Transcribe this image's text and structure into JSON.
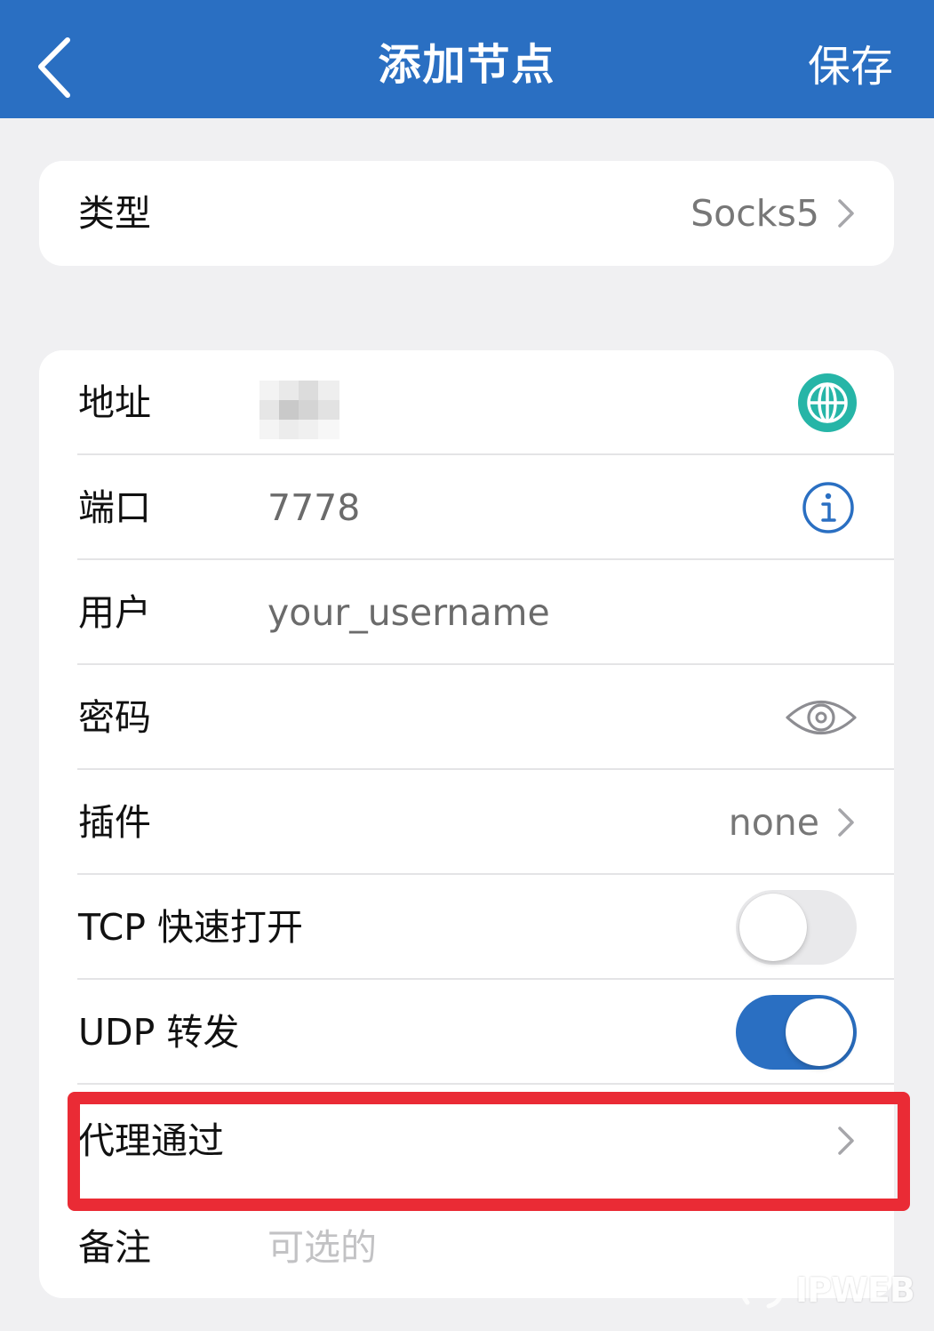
{
  "header": {
    "title": "添加节点",
    "save_label": "保存",
    "back_icon": "chevron-left-icon"
  },
  "type_row": {
    "label": "类型",
    "value": "Socks5"
  },
  "fields": {
    "address": {
      "label": "地址",
      "value": "",
      "icon": "globe-icon"
    },
    "port": {
      "label": "端口",
      "value": "7778",
      "icon": "info-icon"
    },
    "user": {
      "label": "用户",
      "value": "your_username"
    },
    "password": {
      "label": "密码",
      "value": "",
      "icon": "eye-icon"
    },
    "plugin": {
      "label": "插件",
      "value": "none"
    },
    "tcp_fast_open": {
      "label": "TCP 快速打开",
      "enabled": false
    },
    "udp_relay": {
      "label": "UDP 转发",
      "enabled": true
    },
    "proxy_via": {
      "label": "代理通过"
    },
    "remark": {
      "label": "备注",
      "placeholder": "可选的"
    }
  },
  "watermark": {
    "text": "IPWEB"
  },
  "colors": {
    "accent": "#2a6fc2",
    "globe": "#26b5a7",
    "highlight": "#ea2b35",
    "background": "#f0f0f2"
  }
}
